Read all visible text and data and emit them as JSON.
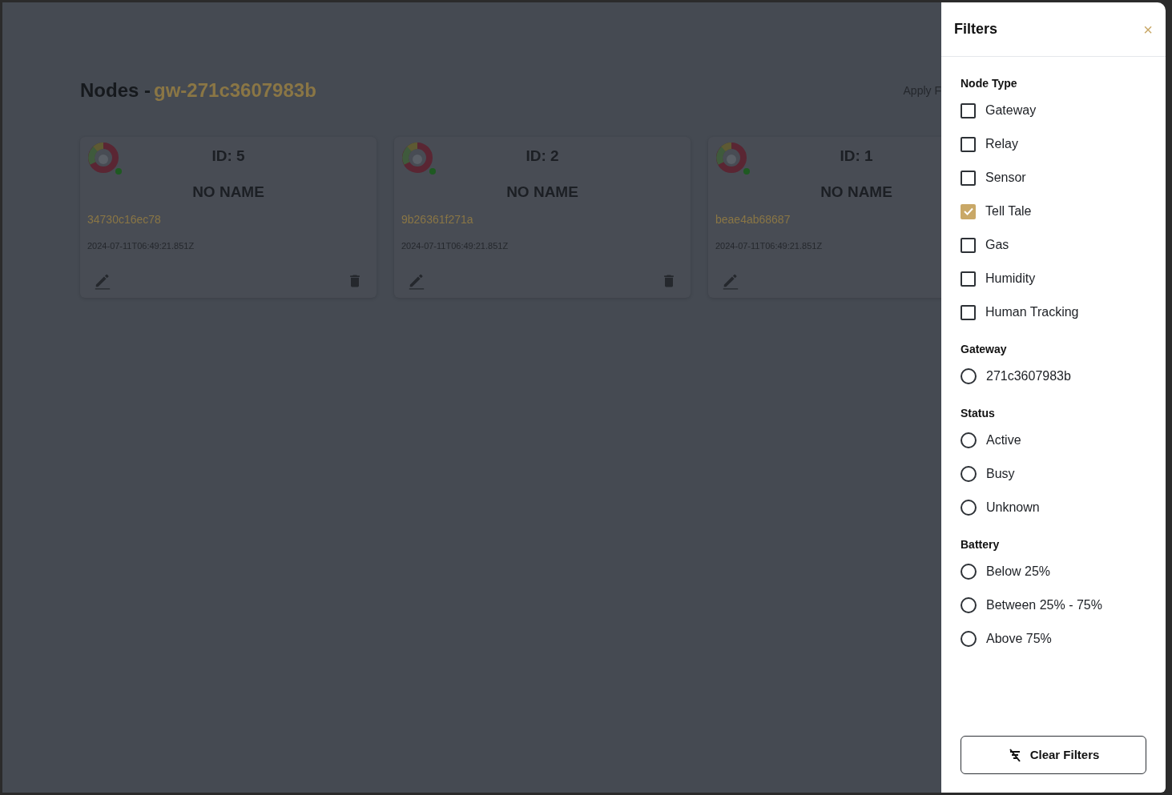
{
  "page": {
    "title": "Nodes -",
    "gateway": "gw-271c3607983b",
    "apply_link": "Apply F"
  },
  "nodes": [
    {
      "id_label": "ID: 5",
      "name": "NO NAME",
      "address": "34730c16ec78",
      "timestamp": "2024-07-11T06:49:21.851Z",
      "online": true,
      "deletable": true
    },
    {
      "id_label": "ID: 2",
      "name": "NO NAME",
      "address": "9b26361f271a",
      "timestamp": "2024-07-11T06:49:21.851Z",
      "online": true,
      "deletable": true
    },
    {
      "id_label": "ID: 1",
      "name": "NO NAME",
      "address": "beae4ab68687",
      "timestamp": "2024-07-11T06:49:21.851Z",
      "online": true,
      "deletable": false
    }
  ],
  "filters": {
    "title": "Filters",
    "close": "×",
    "sections": [
      {
        "title": "Node Type",
        "kind": "checkbox",
        "options": [
          {
            "label": "Gateway",
            "checked": false
          },
          {
            "label": "Relay",
            "checked": false
          },
          {
            "label": "Sensor",
            "checked": false
          },
          {
            "label": "Tell Tale",
            "checked": true
          },
          {
            "label": "Gas",
            "checked": false
          },
          {
            "label": "Humidity",
            "checked": false
          },
          {
            "label": "Human Tracking",
            "checked": false
          }
        ]
      },
      {
        "title": "Gateway",
        "kind": "radio",
        "options": [
          {
            "label": "271c3607983b",
            "checked": false
          }
        ]
      },
      {
        "title": "Status",
        "kind": "radio",
        "options": [
          {
            "label": "Active",
            "checked": false
          },
          {
            "label": "Busy",
            "checked": false
          },
          {
            "label": "Unknown",
            "checked": false
          }
        ]
      },
      {
        "title": "Battery",
        "kind": "radio",
        "options": [
          {
            "label": "Below 25%",
            "checked": false
          },
          {
            "label": "Between 25% - 75%",
            "checked": false
          },
          {
            "label": "Above 75%",
            "checked": false
          }
        ]
      }
    ],
    "clear_button": "Clear Filters"
  }
}
